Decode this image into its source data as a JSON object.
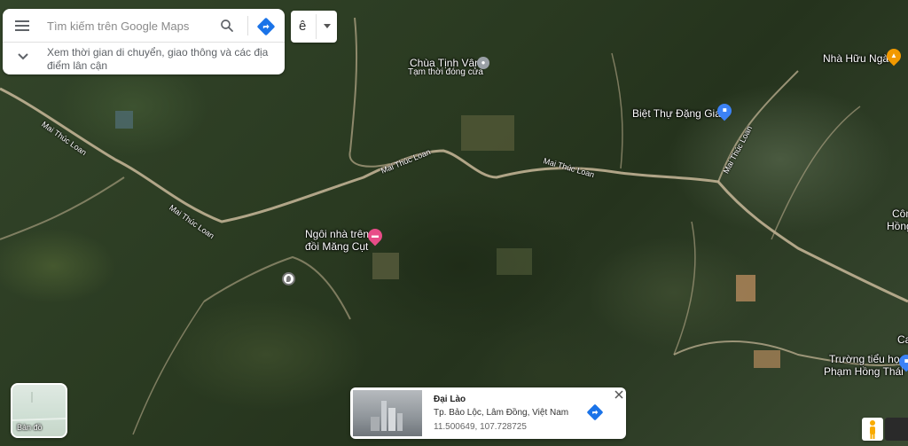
{
  "search": {
    "placeholder": "Tìm kiếm trên Google Maps",
    "nearby_text": "Xem thời gian di chuyển, giao thông và các địa điểm lân cận"
  },
  "layer_button": {
    "letter": "ê"
  },
  "map_labels": {
    "chua_tinh_van": "Chùa Tịnh Vân",
    "chua_tinh_van_status": "Tạm thời đóng cửa",
    "nha_huu_nga": "Nhà Hữu Ngà",
    "biet_thu_dang_gia": "Biệt Thự Đặng Gia",
    "ngoi_nha_line1": "Ngôi nhà trên",
    "ngoi_nha_line2": "đồi Măng Cụt",
    "truong_line1": "Trường tiểu học",
    "truong_line2": "Phạm Hồng Thái",
    "cong_partial": "Côn",
    "hong_partial": "Hồng",
    "ca_partial": "Ca"
  },
  "road_labels": {
    "r1": "Mai Thúc Loan",
    "r2": "Mai Thúc Loan",
    "r3": "Mai Thúc Loan",
    "r4": "Mai Thúc Loan",
    "r5": "Mai Thúc Loan"
  },
  "minimap": {
    "label": "Bản đồ"
  },
  "place_card": {
    "title": "Đại Lào",
    "address": "Tp. Bảo Lộc, Lâm Đồng, Việt Nam",
    "coords": "11.500649, 107.728725"
  },
  "colors": {
    "directions_blue": "#1a73e8",
    "pin_gray": "#9aa0a6",
    "pin_pink": "#e84c88",
    "pin_blue": "#3c82f6",
    "pin_orange": "#f29900"
  },
  "icons": [
    "menu-icon",
    "search-icon",
    "directions-icon",
    "chevron-down-icon",
    "close-icon",
    "pegman-icon"
  ]
}
